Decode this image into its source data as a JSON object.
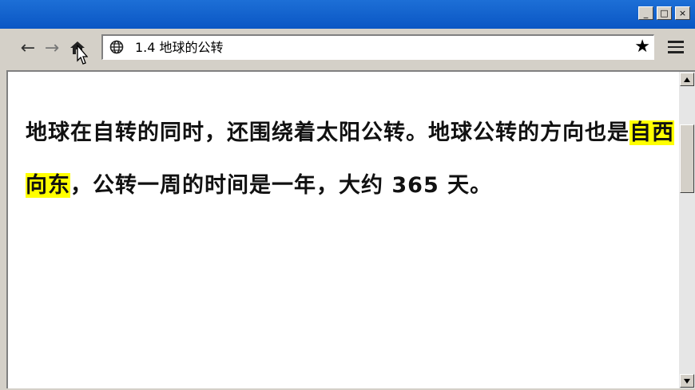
{
  "window": {
    "controls": {
      "minimize": "_",
      "maximize": "□",
      "close": "×"
    }
  },
  "toolbar": {
    "back_glyph": "←",
    "forward_glyph": "→",
    "home_icon": "home-icon",
    "address": "1.4  地球的公转",
    "star_glyph": "★",
    "menu_icon": "hamburger-menu-icon"
  },
  "content": {
    "text_before": "地球在自转的同时，还围绕着太阳公转。地球公转的方向也是",
    "highlight": "自西向东",
    "text_after": "，公转一周的时间是一年，大约 365 天。"
  },
  "colors": {
    "title_bar": "#0a56c4",
    "highlight": "#ffff00",
    "chrome": "#d4d0c8"
  }
}
